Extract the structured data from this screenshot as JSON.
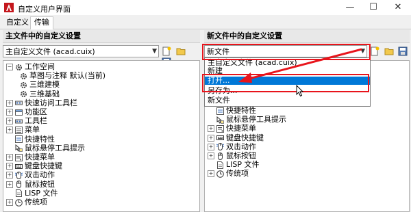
{
  "window": {
    "title": "自定义用户界面",
    "minimize_glyph": "—",
    "maximize_glyph": "☐",
    "close_glyph": "✕"
  },
  "tabs": [
    {
      "label": "自定义"
    },
    {
      "label": "传输",
      "active": true
    }
  ],
  "left_pane": {
    "header": "主文件中的自定义设置",
    "file_combo_value": "主自定义文件 (acad.cuix)",
    "tree": [
      {
        "label": "工作空间",
        "expander": "⊟",
        "icon": "gear-icon"
      },
      {
        "label": "草图与注释 默认(当前)",
        "icon": "gear-icon"
      },
      {
        "label": "三维建模",
        "icon": "gear-icon"
      },
      {
        "label": "三维基础",
        "icon": "gear-icon"
      },
      {
        "label": "快速访问工具栏",
        "expander": "⊞",
        "icon": "toolbar-icon"
      },
      {
        "label": "功能区",
        "expander": "⊞",
        "icon": "ribbon-icon"
      },
      {
        "label": "工具栏",
        "expander": "⊞",
        "icon": "toolbar-icon"
      },
      {
        "label": "菜单",
        "expander": "⊞",
        "icon": "menu-icon"
      },
      {
        "label": "快捷特性",
        "icon": "quick-properties-icon"
      },
      {
        "label": "鼠标悬停工具提示",
        "icon": "tooltip-icon"
      },
      {
        "label": "快捷菜单",
        "expander": "⊞",
        "icon": "shortcut-menu-icon"
      },
      {
        "label": "键盘快捷键",
        "expander": "⊞",
        "icon": "keyboard-icon"
      },
      {
        "label": "双击动作",
        "expander": "⊞",
        "icon": "double-click-icon"
      },
      {
        "label": "鼠标按钮",
        "expander": "⊞",
        "icon": "mouse-icon"
      },
      {
        "label": "LISP 文件",
        "icon": "lisp-file-icon"
      },
      {
        "label": "传统项",
        "expander": "⊞",
        "icon": "legacy-icon"
      }
    ]
  },
  "right_pane": {
    "header": "新文件中的自定义设置",
    "file_combo_value": "新文件",
    "tree": [
      {
        "label": "快捷特性",
        "icon": "quick-properties-icon"
      },
      {
        "label": "鼠标悬停工具提示",
        "icon": "tooltip-icon"
      },
      {
        "label": "快捷菜单",
        "expander": "⊞",
        "icon": "shortcut-menu-icon"
      },
      {
        "label": "键盘快捷键",
        "expander": "⊞",
        "icon": "keyboard-icon"
      },
      {
        "label": "双击动作",
        "expander": "⊞",
        "icon": "double-click-icon"
      },
      {
        "label": "鼠标按钮",
        "expander": "⊞",
        "icon": "mouse-icon"
      },
      {
        "label": "LISP 文件",
        "icon": "lisp-file-icon"
      },
      {
        "label": "传统项",
        "expander": "⊞",
        "icon": "legacy-icon"
      }
    ]
  },
  "dropdown": {
    "items": [
      {
        "label": "主自定义文件 (acad.cuix)"
      },
      {
        "label": "新建"
      },
      {
        "label": "打开...",
        "highlighted": true
      },
      {
        "label": "另存为..."
      },
      {
        "label": "新文件"
      }
    ]
  },
  "colors": {
    "highlight": "#0078d7",
    "annotation_red": "#e8141b"
  }
}
